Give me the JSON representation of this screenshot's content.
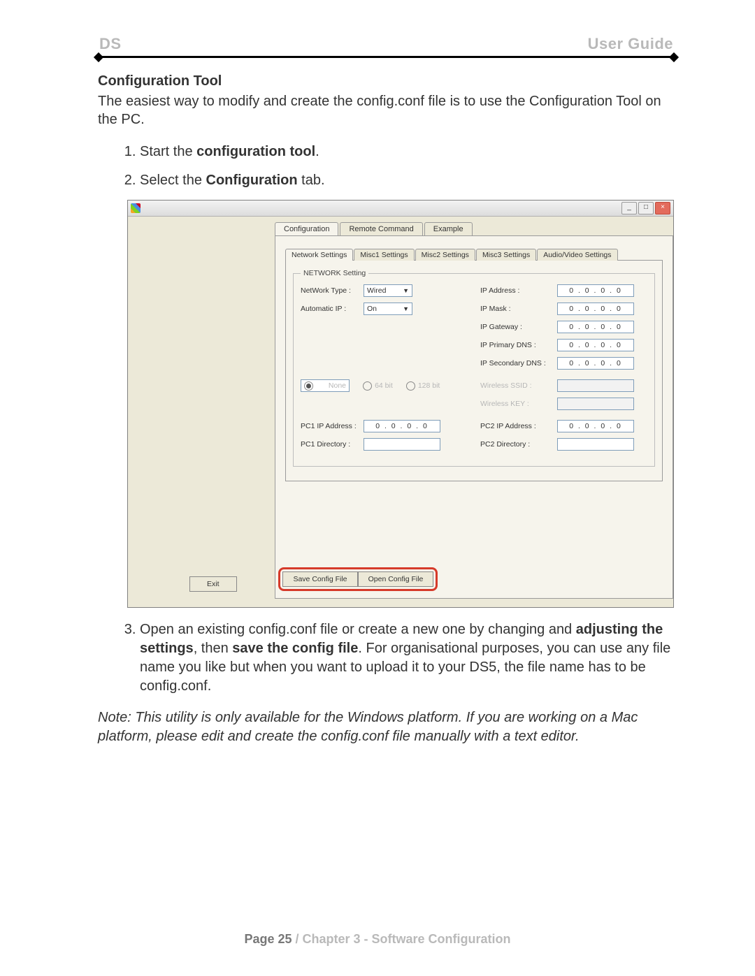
{
  "header": {
    "left": "DS",
    "right": "User Guide"
  },
  "section_title": "Configuration Tool",
  "intro": "The easiest way to modify and create the config.conf file is to use the Configuration Tool on the PC.",
  "steps": {
    "s1_pre": "Start the ",
    "s1_bold": "configuration tool",
    "s1_post": ".",
    "s2_pre": "Select the ",
    "s2_bold": "Configuration",
    "s2_post": " tab.",
    "s3_a": "Open an existing config.conf file or create a new one by changing and ",
    "s3_b1": "adjusting the settings",
    "s3_c": ", then ",
    "s3_b2": "save the config file",
    "s3_d": ". For organisational purposes, you can use any file name you like but when you want to upload it to your DS5, the file name has to be config.conf."
  },
  "note": "Note: This utility is only available for the Windows platform. If you are working on a Mac platform, please edit and create the config.conf file manually with a text editor.",
  "footer": {
    "page": "Page 25",
    "sep": "  /  ",
    "chapter": "Chapter 3 - Software Configuration"
  },
  "win": {
    "main_tabs": [
      "Configuration",
      "Remote Command",
      "Example"
    ],
    "sub_tabs": [
      "Network Settings",
      "Misc1 Settings",
      "Misc2 Settings",
      "Misc3 Settings",
      "Audio/Video Settings"
    ],
    "group_title": "NETWORK Setting",
    "labels": {
      "net_type": "NetWork Type :",
      "auto_ip": "Automatic IP :",
      "ip_addr": "IP Address :",
      "ip_mask": "IP Mask :",
      "ip_gw": "IP Gateway :",
      "ip_dns1": "IP Primary DNS :",
      "ip_dns2": "IP Secondary DNS :",
      "wssid": "Wireless SSID :",
      "wkey": "Wireless KEY :",
      "pc1ip": "PC1 IP Address :",
      "pc1dir": "PC1 Directory :",
      "pc2ip": "PC2 IP Address :",
      "pc2dir": "PC2 Directory :"
    },
    "values": {
      "net_type": "Wired",
      "auto_ip": "On",
      "ip": "0 . 0 . 0 . 0"
    },
    "radios": [
      "None",
      "64 bit",
      "128 bit"
    ],
    "buttons": {
      "save": "Save Config File",
      "open": "Open Config File",
      "exit": "Exit"
    },
    "ctrl": {
      "min": "_",
      "max": "□",
      "close": "×"
    }
  }
}
